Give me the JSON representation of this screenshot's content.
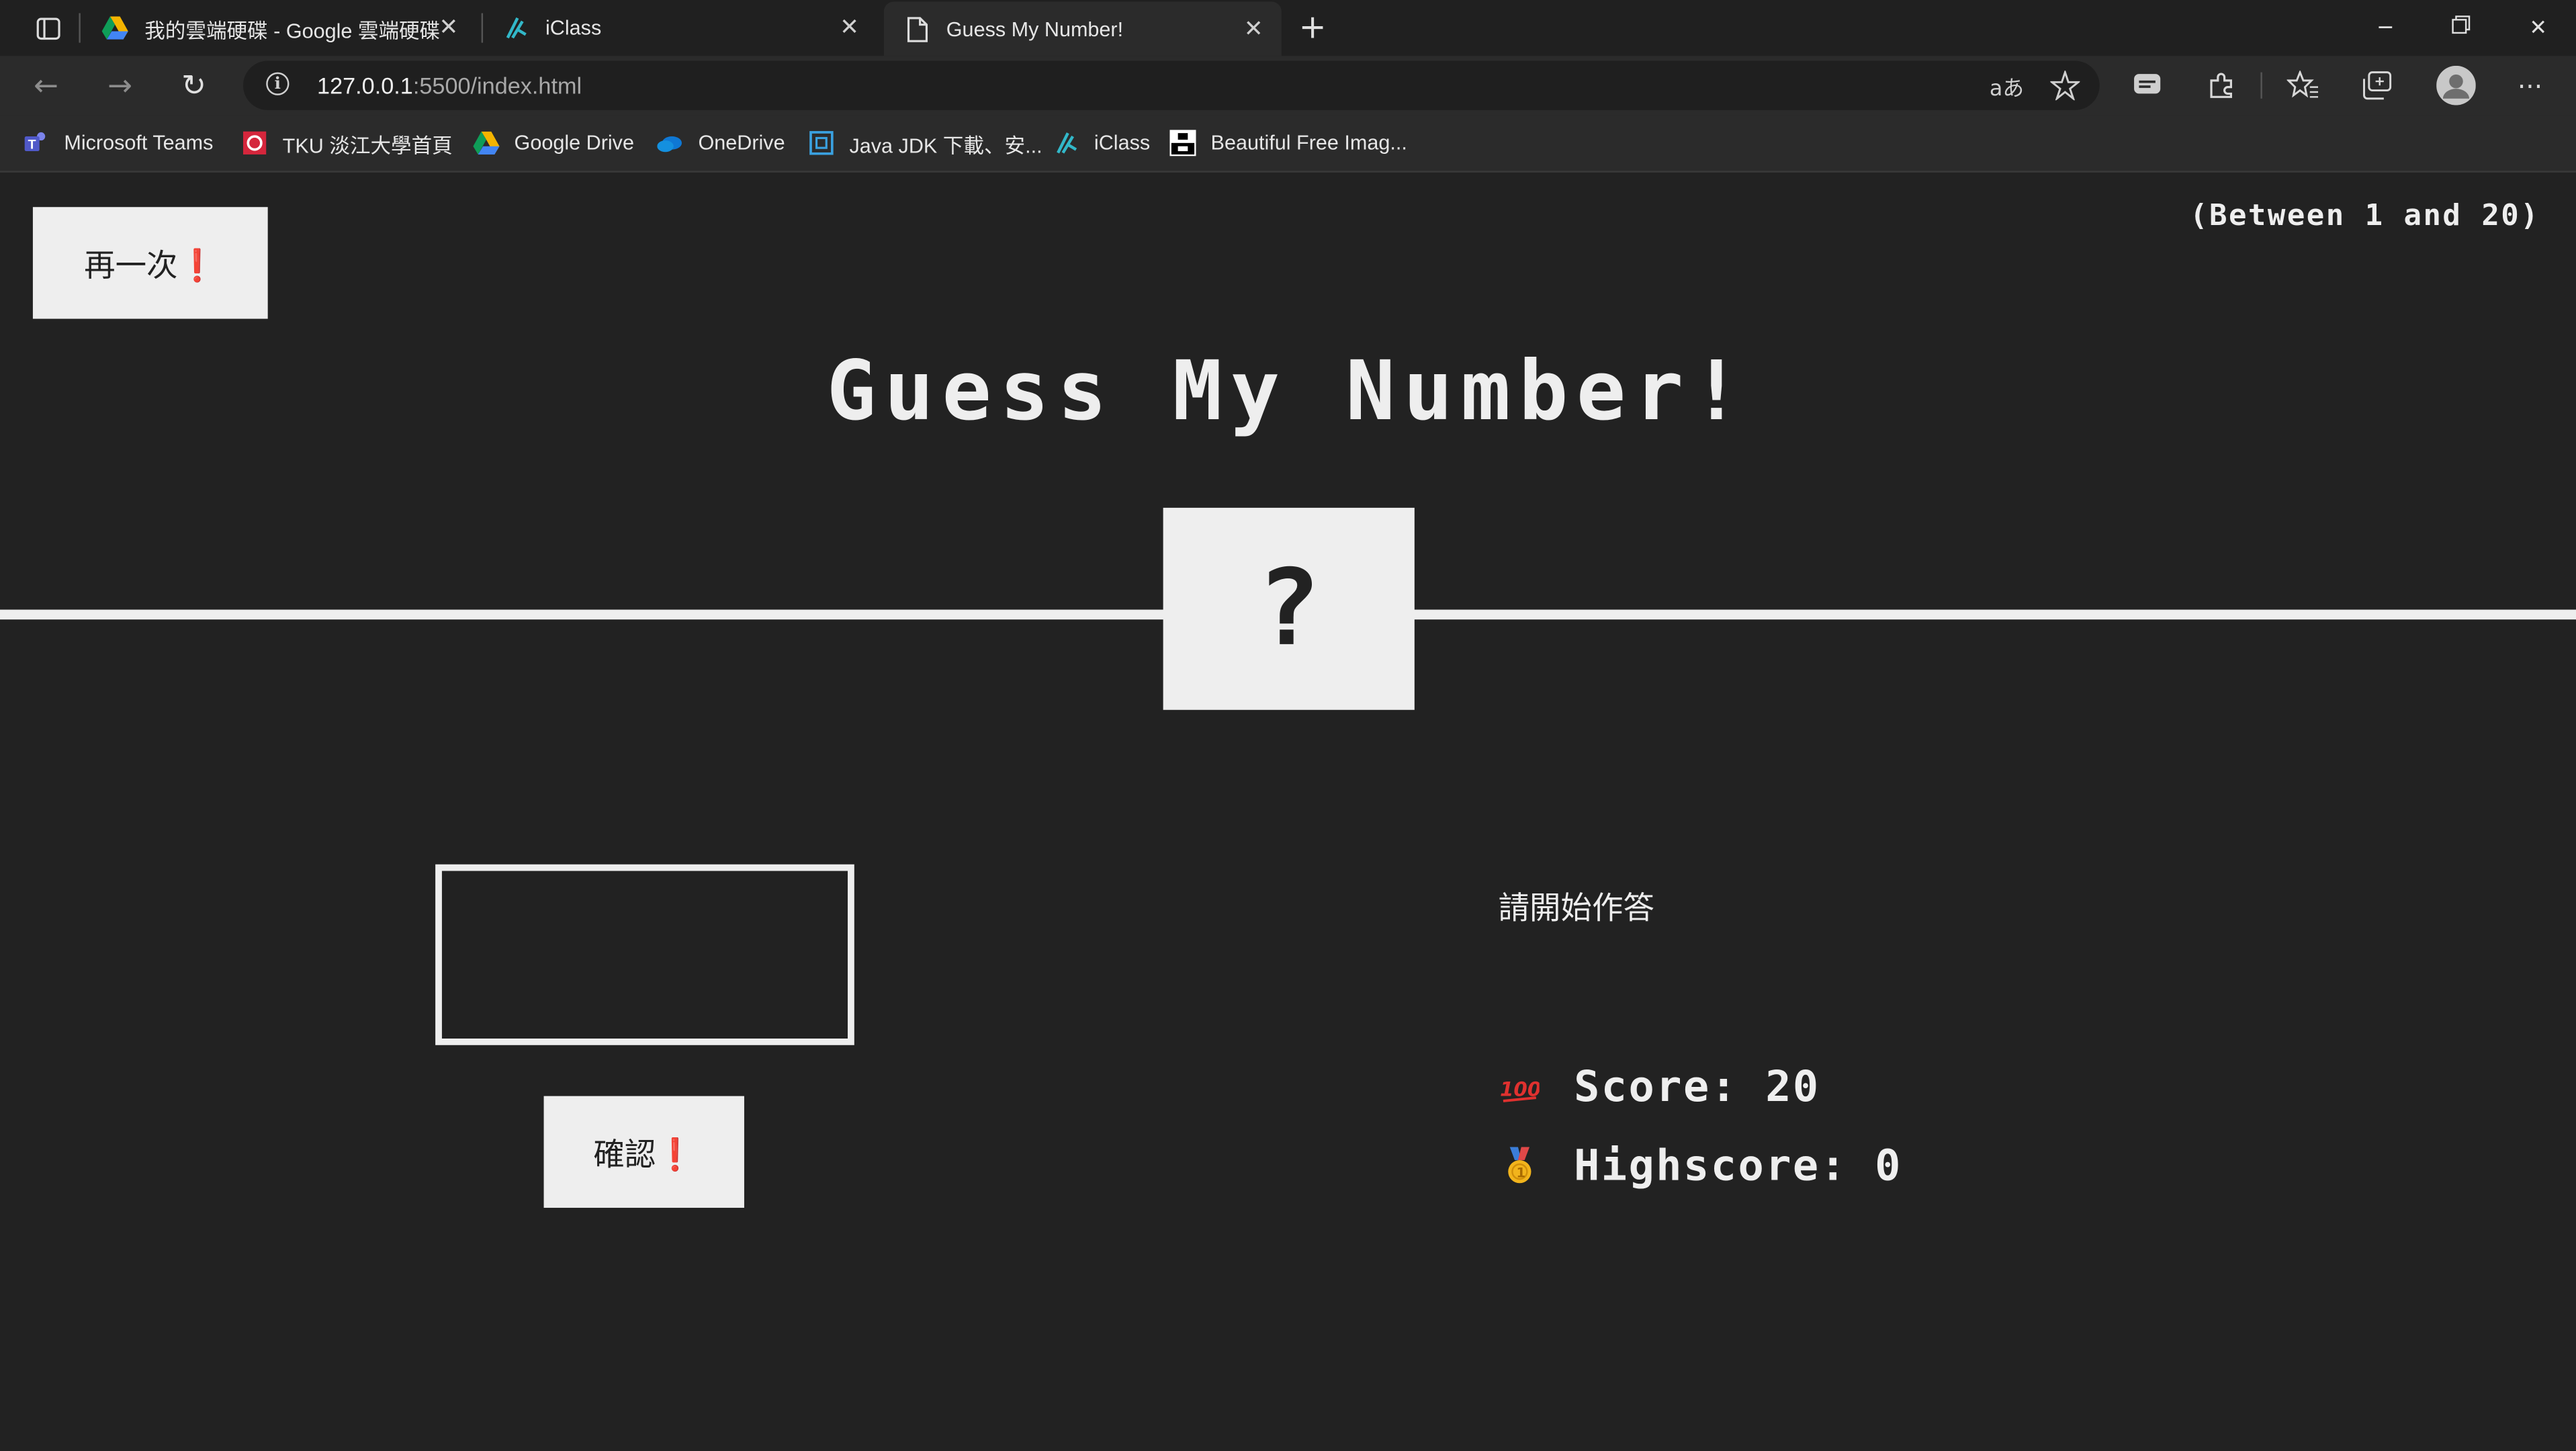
{
  "browser": {
    "tabs": [
      {
        "title": "我的雲端硬碟 - Google 雲端硬碟",
        "icon": "google-drive-icon"
      },
      {
        "title": "iClass",
        "icon": "iclass-icon"
      },
      {
        "title": "Guess My Number!",
        "icon": "document-icon",
        "active": true
      }
    ],
    "url_host": "127.0.0.1",
    "url_rest": ":5500/index.html",
    "bookmarks": [
      {
        "label": "Microsoft Teams",
        "icon": "teams-icon"
      },
      {
        "label": "TKU 淡江大學首頁",
        "icon": "tku-icon"
      },
      {
        "label": "Google Drive",
        "icon": "google-drive-icon"
      },
      {
        "label": "OneDrive",
        "icon": "onedrive-icon"
      },
      {
        "label": "Java JDK 下載、安...",
        "icon": "java-icon"
      },
      {
        "label": "iClass",
        "icon": "iclass-icon"
      },
      {
        "label": "Beautiful Free Imag...",
        "icon": "unsplash-icon"
      }
    ],
    "translate_label": "aあ"
  },
  "game": {
    "again_label": "再一次❗",
    "between_label": "(Between 1 and 20)",
    "title": "Guess My Number!",
    "secret_display": "?",
    "guess_value": "",
    "check_label": "確認❗",
    "message": "請開始作答",
    "score_label": "Score: 20",
    "highscore_label": "Highscore: 0",
    "score_icon": "💯",
    "highscore_icon": "🥇"
  },
  "colors": {
    "background": "#222222",
    "foreground": "#eeeeee"
  }
}
